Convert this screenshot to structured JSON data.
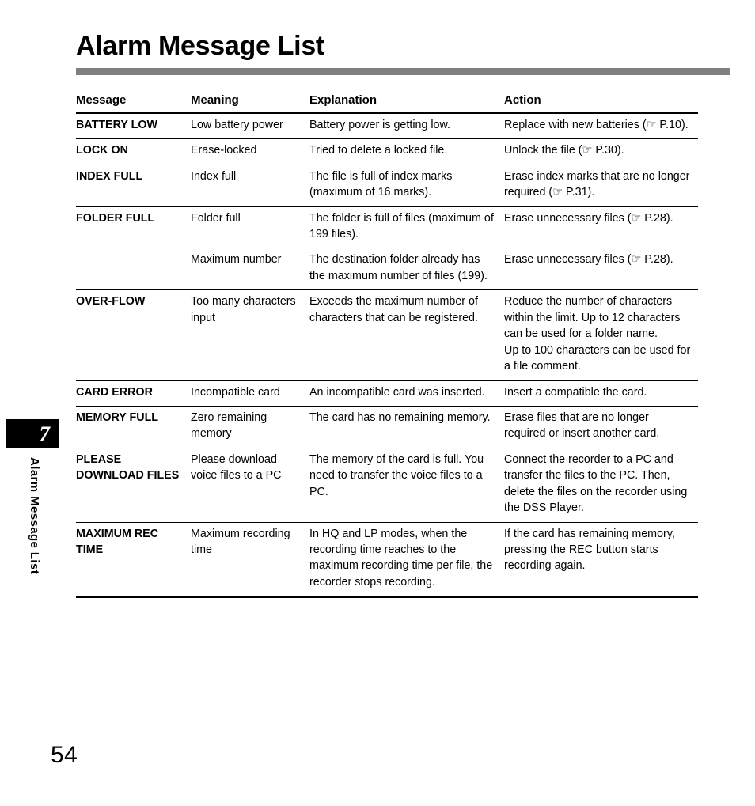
{
  "page": {
    "title": "Alarm Message List",
    "number": "54",
    "chapter_number": "7",
    "chapter_label": "Alarm Message List",
    "rule_color": "#808080"
  },
  "table": {
    "headers": {
      "message": "Message",
      "meaning": "Meaning",
      "explanation": "Explanation",
      "action": "Action"
    },
    "rows": [
      {
        "message": "BATTERY LOW",
        "meaning": "Low battery power",
        "explanation": "Battery power is getting low.",
        "action": "Replace with new batteries (☞ P.10)."
      },
      {
        "message": "LOCK ON",
        "meaning": "Erase-locked",
        "explanation": "Tried to delete a locked file.",
        "action": "Unlock the file (☞ P.30)."
      },
      {
        "message": "INDEX FULL",
        "meaning": "Index full",
        "explanation": "The file is full of index marks (maximum of 16 marks).",
        "action": "Erase index marks that are no longer required (☞ P.31)."
      },
      {
        "message": "FOLDER FULL",
        "meaning": "Folder full",
        "explanation": "The folder is full of files (maximum of 199 files).",
        "action": "Erase unnecessary files (☞ P.28)."
      },
      {
        "message": "",
        "meaning": "Maximum number",
        "explanation": "The destination folder already has the maximum number of files (199).",
        "action": "Erase unnecessary files (☞ P.28)."
      },
      {
        "message": "OVER-FLOW",
        "meaning": "Too many characters input",
        "explanation": "Exceeds the maximum number of characters that can be registered.",
        "action": "Reduce the number of characters within the limit. Up to 12 characters can be used for a folder name.\nUp to 100 characters can be used for a file comment."
      },
      {
        "message": "CARD ERROR",
        "meaning": "Incompatible card",
        "explanation": "An incompatible card was inserted.",
        "action": "Insert a compatible the card."
      },
      {
        "message": "MEMORY FULL",
        "meaning": "Zero remaining memory",
        "explanation": "The card has no remaining memory.",
        "action": "Erase files that are no longer required or insert another card."
      },
      {
        "message": "PLEASE DOWNLOAD FILES",
        "meaning": "Please download voice files to a PC",
        "explanation": "The memory of the card is full. You need to transfer the voice files to a PC.",
        "action": "Connect the recorder to a PC and transfer the files to the PC. Then, delete the files on the recorder using the DSS Player."
      },
      {
        "message": "MAXIMUM REC TIME",
        "meaning": "Maximum recording time",
        "explanation": "In HQ and LP modes, when the recording time reaches to the maximum recording time per file, the recorder stops recording.",
        "action": "If the card has remaining memory, pressing the REC button starts recording again."
      }
    ]
  }
}
